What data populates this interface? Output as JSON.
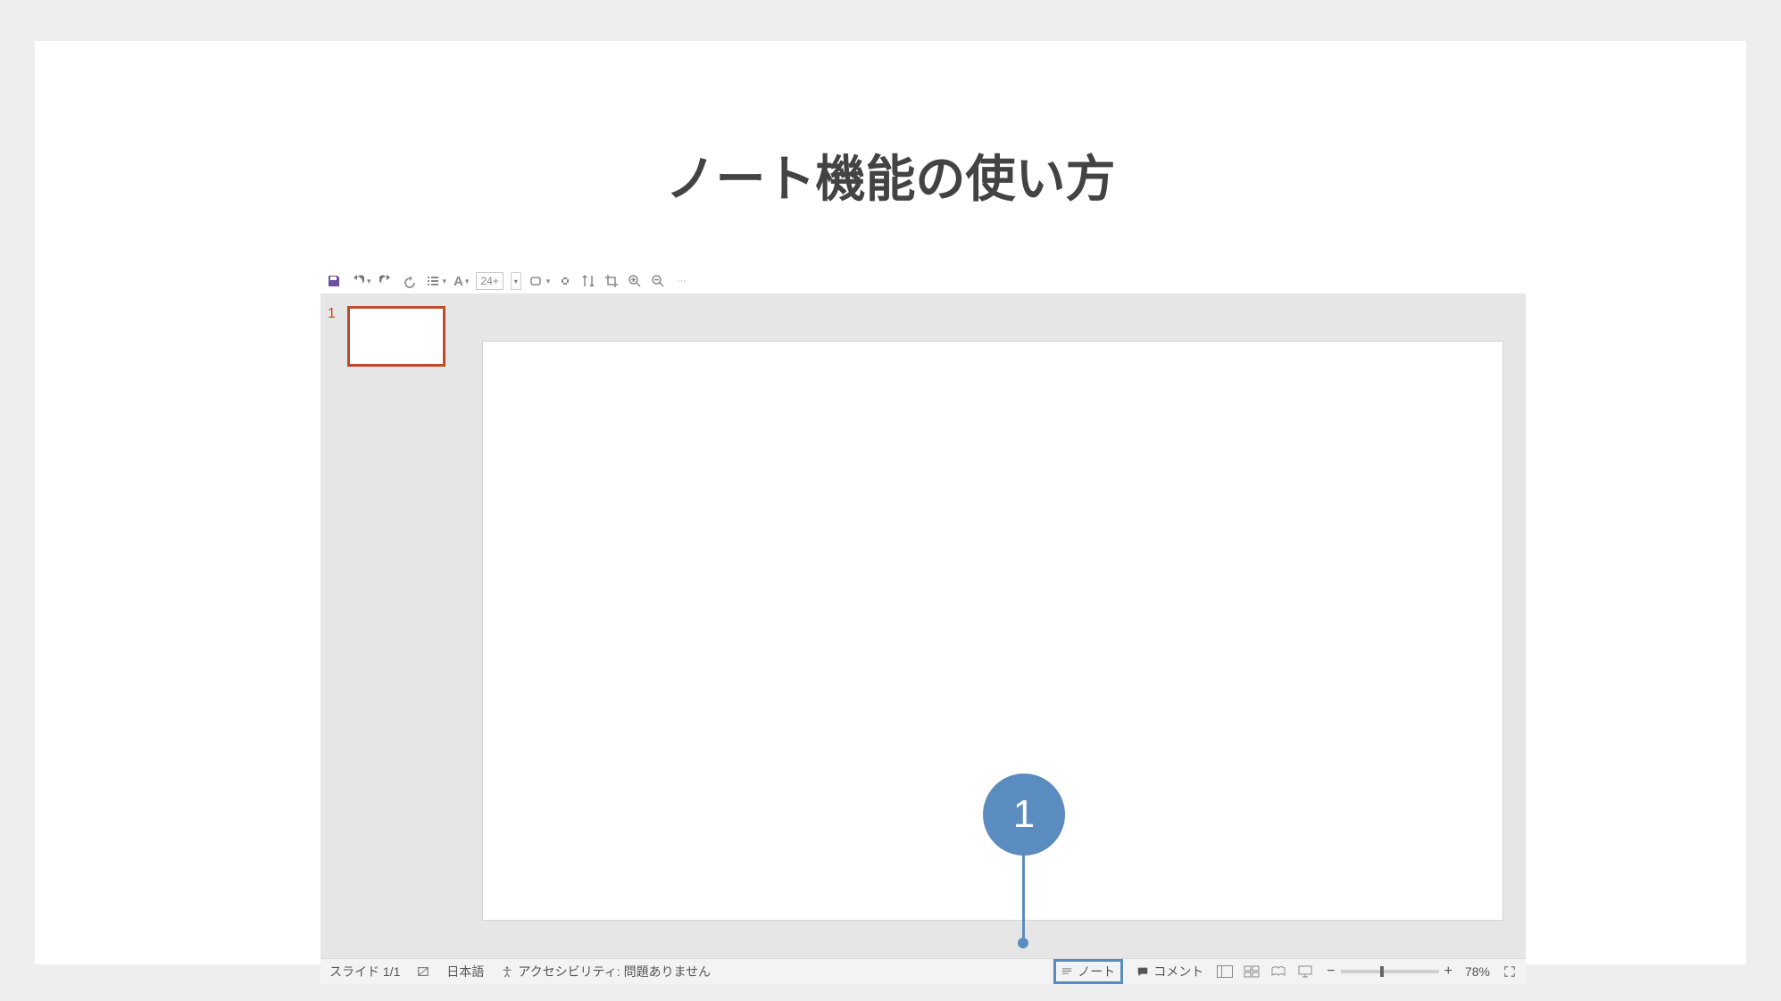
{
  "title": "ノート機能の使い方",
  "toolbar": {
    "font_size": "24+",
    "font_letter": "A"
  },
  "sidebar": {
    "thumbs": [
      {
        "number": "1"
      }
    ]
  },
  "statusbar": {
    "slide_indicator": "スライド 1/1",
    "language": "日本語",
    "accessibility": "アクセシビリティ: 問題ありません",
    "notes_label": "ノート",
    "comments_label": "コメント",
    "zoom_percent": "78%",
    "zoom_minus": "−",
    "zoom_plus": "+"
  },
  "annotation": {
    "badge": "1"
  }
}
